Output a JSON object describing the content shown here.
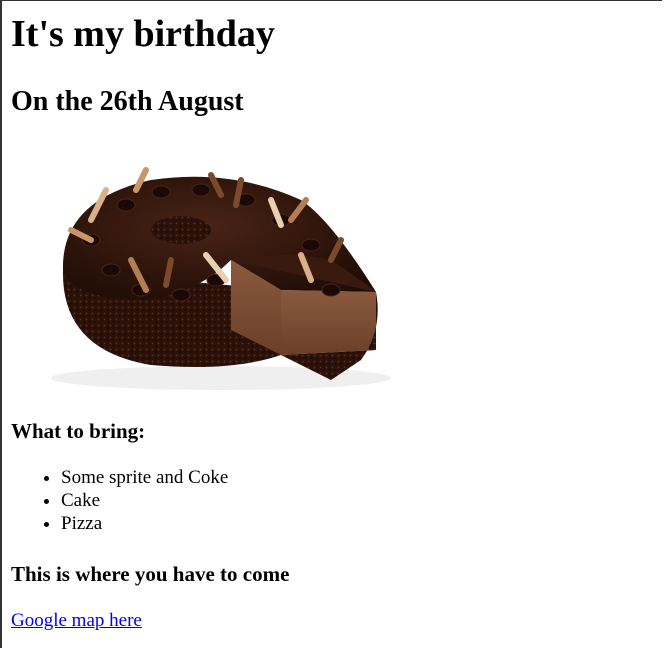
{
  "page": {
    "title": "It's my birthday",
    "date_heading": "On the 26th August",
    "cake_image_alt": "Chocolate cake with a slice cut out",
    "bring_heading": "What to bring:",
    "bring_items": [
      "Some sprite and Coke",
      "Cake",
      "Pizza"
    ],
    "location_heading": "This is where you have to come",
    "map_link_text": "Google map here"
  },
  "colors": {
    "link": "#0000ee",
    "text": "#000000",
    "background": "#ffffff"
  }
}
